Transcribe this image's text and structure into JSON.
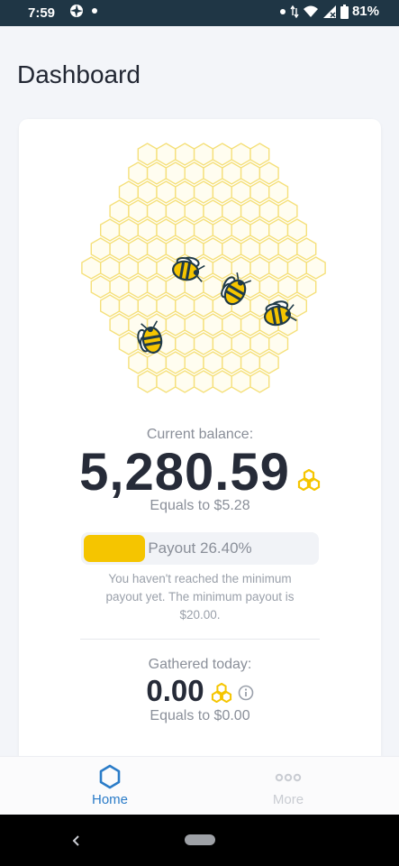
{
  "status_bar": {
    "time": "7:59",
    "battery": "81%"
  },
  "page": {
    "title": "Dashboard"
  },
  "balance": {
    "label": "Current balance:",
    "value": "5,280.59",
    "equals": "Equals to $5.28"
  },
  "payout": {
    "progress_text": "Payout 26.40%",
    "progress_fraction": 0.264,
    "note": "You haven't reached the minimum payout yet. The minimum payout is $20.00."
  },
  "gathered": {
    "label": "Gathered today:",
    "value": "0.00",
    "equals": "Equals to $0.00"
  },
  "nav": {
    "home_label": "Home",
    "more_label": "More"
  },
  "colors": {
    "accent": "#2b7cc8",
    "honey": "#f5c500",
    "status_bar": "#1f3645"
  },
  "icons": {
    "hive": "honeycomb-hive",
    "unit": "honeycomb-cluster-icon",
    "info": "info-icon",
    "home": "hexagon-icon",
    "more": "dots-icon"
  }
}
